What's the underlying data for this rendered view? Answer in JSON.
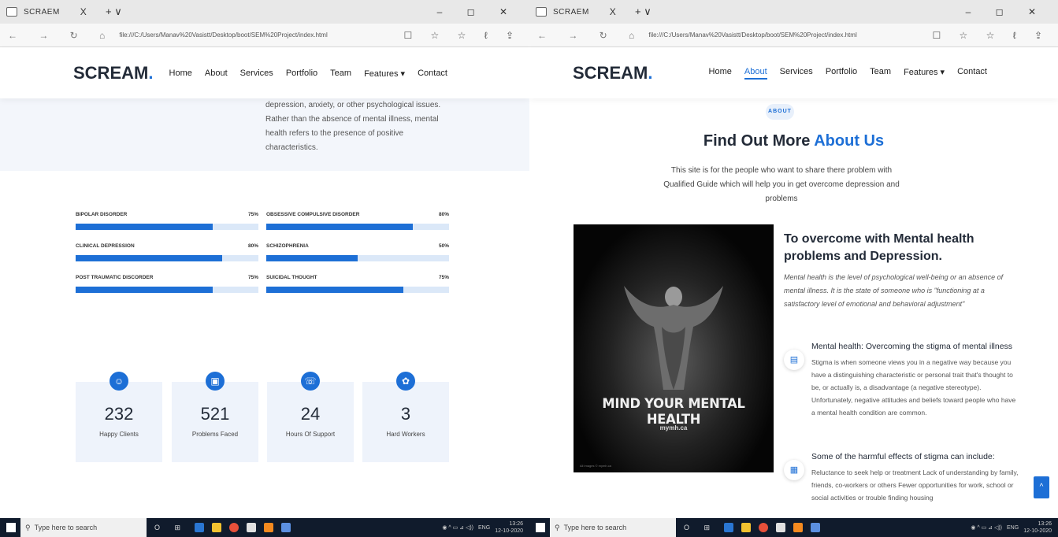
{
  "browser": {
    "tab_title": "SCRAEM",
    "url": "file:///C:/Users/Manav%20Vasistt/Desktop/boot/SEM%20Project/index.html",
    "nav_buttons": "← → ↻ ⌂",
    "tool_icons": "☐ ☆ ☆ ℓ ⇪",
    "win_controls": "– ◻ ✕",
    "tab_close": "X",
    "tab_new": "+ ∨"
  },
  "site": {
    "logo": "SCREAM",
    "logo_dot": ".",
    "menu": [
      "Home",
      "About",
      "Services",
      "Portfolio",
      "Team",
      "Features ▾",
      "Contact"
    ]
  },
  "left": {
    "intro_text": "depression, anxiety, or other psychological issues. Rather than the absence of mental illness, mental health refers to the presence of positive characteristics.",
    "skills": [
      {
        "name": "BIPOLAR DISORDER",
        "percent": "75%",
        "value": 0.75
      },
      {
        "name": "OBSESSIVE COMPULSIVE DISORDER",
        "percent": "80%",
        "value": 0.8
      },
      {
        "name": "CLINICAL DEPRESSION",
        "percent": "80%",
        "value": 0.8
      },
      {
        "name": "SCHIZOPHRENIA",
        "percent": "50%",
        "value": 0.5
      },
      {
        "name": "POST TRAUMATIC DISCORDER",
        "percent": "75%",
        "value": 0.75
      },
      {
        "name": "SUICIDAL THOUGHT",
        "percent": "75%",
        "value": 0.75
      }
    ],
    "stats": [
      {
        "number": "232",
        "label": "Happy Clients",
        "icon": "☺"
      },
      {
        "number": "521",
        "label": "Problems Faced",
        "icon": "▣"
      },
      {
        "number": "24",
        "label": "Hours Of Support",
        "icon": "☏"
      },
      {
        "number": "3",
        "label": "Hard Workers",
        "icon": "✿"
      }
    ]
  },
  "right": {
    "badge": "ABOUT",
    "title_plain": "Find Out More",
    "title_highlight": "About Us",
    "description": "This site is for the people who want to share there problem with Qualified Guide which will help you in get overcome depression and problems",
    "poster": {
      "title": "MIND YOUR MENTAL HEALTH",
      "site": "mymh.ca",
      "footer": "All images © mymh.ca"
    },
    "heading": "To overcome with Mental health problems and Depression.",
    "italic": "Mental health is the level of psychological well-being or an absence of mental illness. It is the state of someone who is \"functioning at a satisfactory level of emotional and behavioral adjustment\"",
    "features": [
      {
        "title": "Mental health: Overcoming the stigma of mental illness",
        "text": "Stigma is when someone views you in a negative way because you have a distinguishing characteristic or personal trait that's thought to be, or actually is, a disadvantage (a negative stereotype). Unfortunately, negative attitudes and beliefs toward people who have a mental health condition are common.",
        "icon": "▤"
      },
      {
        "title": "Some of the harmful effects of stigma can include:",
        "text": "Reluctance to seek help or treatment Lack of understanding by family, friends, co-workers or others Fewer opportunities for work, school or social activities or trouble finding housing",
        "icon": "▦"
      }
    ],
    "back_to_top": "^"
  },
  "taskbar": {
    "search_placeholder": "Type here to search",
    "lang": "ENG",
    "time": "13:26",
    "date": "12-10-2020",
    "taskview": "O ⊞"
  }
}
